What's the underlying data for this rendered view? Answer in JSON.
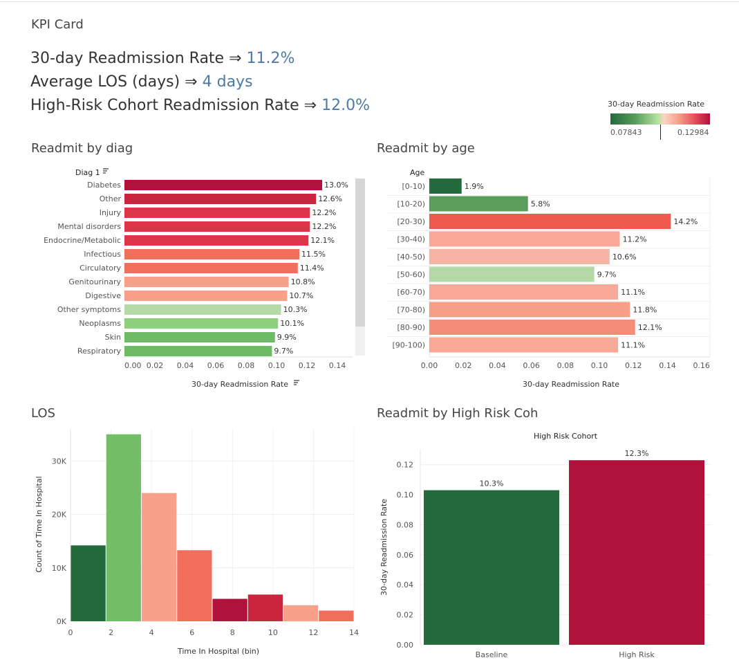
{
  "kpi": {
    "title": "KPI Card",
    "readmission_label": "30-day Readmission Rate ⇒",
    "readmission_value": "11.2%",
    "los_label": "Average LOS (days) ⇒",
    "los_value": "4 days",
    "highrisk_label": "High-Risk Cohort Readmission Rate ⇒",
    "highrisk_value": "12.0%"
  },
  "legend": {
    "title": "30-day Readmission Rate",
    "min": "0.07843",
    "max": "0.12984"
  },
  "sections": {
    "diag": "Readmit by diag",
    "age": "Readmit by age",
    "los": "LOS",
    "highrisk": "Readmit by High Risk Coh"
  },
  "colors": {
    "dark_green": "#236a3d",
    "green": "#5a9c5a",
    "light_green": "#8ed07e",
    "pale_green": "#b5d9a6",
    "salmon": "#f9a08a",
    "light_salmon": "#f7b4a2",
    "orange_red": "#ef6f5c",
    "red": "#e2485a",
    "crimson": "#c9253f",
    "dark_red": "#b0123b"
  },
  "chart_data": [
    {
      "type": "bar",
      "orientation": "horizontal",
      "row_header": "Diag 1",
      "xlabel": "30-day Readmission Rate",
      "xlim": [
        0,
        0.15
      ],
      "x_ticks": [
        "0.00",
        "0.02",
        "0.04",
        "0.06",
        "0.08",
        "0.10",
        "0.12",
        "0.14"
      ],
      "categories": [
        "Diabetes",
        "Other",
        "Injury",
        "Mental disorders",
        "Endocrine/Metabolic",
        "Infectious",
        "Circulatory",
        "Genitourinary",
        "Digestive",
        "Other symptoms",
        "Neoplasms",
        "Skin",
        "Respiratory"
      ],
      "values": [
        0.13,
        0.126,
        0.122,
        0.122,
        0.121,
        0.115,
        0.114,
        0.108,
        0.107,
        0.103,
        0.101,
        0.099,
        0.097
      ],
      "labels": [
        "13.0%",
        "12.6%",
        "12.2%",
        "12.2%",
        "12.1%",
        "11.5%",
        "11.4%",
        "10.8%",
        "10.7%",
        "10.3%",
        "10.1%",
        "9.9%",
        "9.7%"
      ],
      "colors": [
        "#b0123b",
        "#c9253f",
        "#dc3549",
        "#dc3549",
        "#dc3549",
        "#ef6f5c",
        "#ef6f5c",
        "#f9a08a",
        "#f9a08a",
        "#b5d9a6",
        "#8ed07e",
        "#6fba64",
        "#6fba64"
      ]
    },
    {
      "type": "bar",
      "orientation": "horizontal",
      "row_header": "Age",
      "xlabel": "30-day Readmission Rate",
      "xlim": [
        0,
        0.165
      ],
      "x_ticks": [
        "0.00",
        "0.02",
        "0.04",
        "0.06",
        "0.08",
        "0.10",
        "0.12",
        "0.14",
        "0.16"
      ],
      "categories": [
        "[0-10)",
        "[10-20)",
        "[20-30)",
        "[30-40)",
        "[40-50)",
        "[50-60)",
        "[60-70)",
        "[70-80)",
        "[80-90)",
        "[90-100)"
      ],
      "values": [
        0.019,
        0.058,
        0.142,
        0.112,
        0.106,
        0.097,
        0.111,
        0.118,
        0.121,
        0.111
      ],
      "labels": [
        "1.9%",
        "5.8%",
        "14.2%",
        "11.2%",
        "10.6%",
        "9.7%",
        "11.1%",
        "11.8%",
        "12.1%",
        "11.1%"
      ],
      "colors": [
        "#236a3d",
        "#5a9c5a",
        "#ef5a4e",
        "#f9a898",
        "#f7b4a2",
        "#b5d9a6",
        "#f9a898",
        "#f79e88",
        "#f58c78",
        "#f9a898"
      ]
    },
    {
      "type": "bar",
      "subtype": "histogram",
      "xlabel": "Time In Hospital (bin)",
      "ylabel": "Count of Time In Hospital",
      "ylim": [
        0,
        36000
      ],
      "y_ticks": [
        {
          "v": 0,
          "t": "0K"
        },
        {
          "v": 10000,
          "t": "10K"
        },
        {
          "v": 20000,
          "t": "20K"
        },
        {
          "v": 30000,
          "t": "30K"
        }
      ],
      "x_ticks": [
        0,
        2,
        4,
        6,
        8,
        10,
        12,
        14
      ],
      "bins": [
        0,
        2,
        4,
        6,
        8,
        10,
        12,
        14
      ],
      "values": [
        14200,
        35000,
        24000,
        13300,
        4200,
        5000,
        3000,
        2000
      ],
      "colors": [
        "#236a3d",
        "#74be67",
        "#f9a08a",
        "#ef6f5c",
        "#b0123b",
        "#c9253f",
        "#f9a08a",
        "#ef6f5c"
      ]
    },
    {
      "type": "bar",
      "title": "High Risk Cohort",
      "ylabel": "30-day Readmission Rate",
      "ylim": [
        0,
        0.13
      ],
      "y_ticks": [
        "0.00",
        "0.02",
        "0.04",
        "0.06",
        "0.08",
        "0.10",
        "0.12"
      ],
      "categories": [
        "Baseline",
        "High Risk"
      ],
      "values": [
        0.103,
        0.123
      ],
      "labels": [
        "10.3%",
        "12.3%"
      ],
      "colors": [
        "#236a3d",
        "#b0123b"
      ]
    }
  ]
}
